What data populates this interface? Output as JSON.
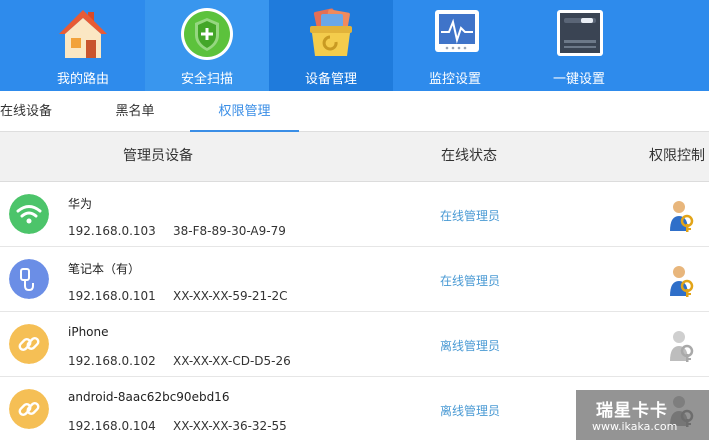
{
  "nav": {
    "items": [
      {
        "label": "我的路由",
        "icon": "house-icon"
      },
      {
        "label": "安全扫描",
        "icon": "shield-icon"
      },
      {
        "label": "设备管理",
        "icon": "device-box-icon"
      },
      {
        "label": "监控设置",
        "icon": "monitor-icon"
      },
      {
        "label": "一键设置",
        "icon": "one-key-settings-icon"
      }
    ],
    "active_index": 2
  },
  "tabs": {
    "items": [
      "在线设备",
      "黑名单",
      "权限管理"
    ],
    "active_index": 2
  },
  "table": {
    "headers": {
      "device": "管理员设备",
      "status": "在线状态",
      "permission": "权限控制"
    },
    "rows": [
      {
        "name": "华为",
        "ip": "192.168.0.103",
        "mac": "38-F8-89-30-A9-79",
        "status": "在线管理员",
        "icon": "wifi-icon",
        "icon_color": "#4cc46a",
        "permission_icon": "admin-key-icon",
        "permission_active": true
      },
      {
        "name": "笔记本（有）",
        "ip": "192.168.0.101",
        "mac": "XX-XX-XX-59-21-2C",
        "status": "在线管理员",
        "icon": "ethernet-cable-icon",
        "icon_color": "#6b8ee6",
        "permission_icon": "admin-key-icon",
        "permission_active": true
      },
      {
        "name": "iPhone",
        "ip": "192.168.0.102",
        "mac": "XX-XX-XX-CD-D5-26",
        "status": "离线管理员",
        "icon": "link-icon",
        "icon_color": "#f5bf55",
        "permission_icon": "admin-key-icon",
        "permission_active": false
      },
      {
        "name": "android-8aac62bc90ebd16",
        "ip": "192.168.0.104",
        "mac": "XX-XX-XX-36-32-55",
        "status": "离线管理员",
        "icon": "link-icon",
        "icon_color": "#f5bf55",
        "permission_icon": "admin-key-icon",
        "permission_active": false
      }
    ]
  },
  "watermark": {
    "title": "瑞星卡卡",
    "url": "www.ikaka.com"
  },
  "colors": {
    "nav_bg": "#2e8bec",
    "nav_active": "#1f7bdc",
    "tab_active": "#3a8ee6",
    "status_text": "#4a9ad4"
  }
}
